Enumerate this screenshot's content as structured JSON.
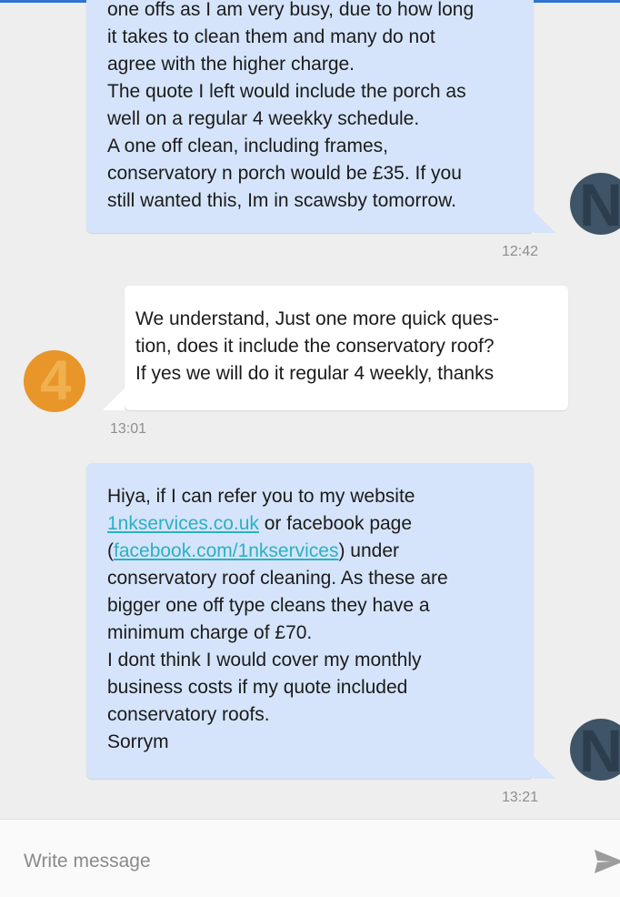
{
  "conversation": {
    "messages": [
      {
        "direction": "outgoing",
        "pre": "one offs as I am very busy, due to how long\nit takes to clean them and many do not\nagree with the higher charge.\nThe quote I left would include the porch as\nwell on a regular 4 weekky schedule.\nA one off clean, including frames,\nconservatory n porch would be £35.  If you\nstill wanted this, Im in scawsby tomorrow.",
        "time": "12:42",
        "avatar_letter": "N"
      },
      {
        "direction": "incoming",
        "pre": "We understand, Just one more quick ques-\ntion, does it include the conservatory roof?\nIf yes we will do it regular 4 weekly, thanks",
        "time": "13:01",
        "avatar_letter": "4"
      },
      {
        "direction": "outgoing",
        "pre": "Hiya, if I can refer you to my website\n",
        "link1": "1nkservices.co.uk",
        "mid1": " or facebook page\n(",
        "link2": "facebook.com/1nkservices",
        "post": ") under\nconservatory roof cleaning. As these are\nbigger one off type cleans they have a\nminimum charge of £70.\nI dont think I would cover my monthly\nbusiness costs if  my quote included\nconservatory roofs.\nSorrym",
        "time": "13:21",
        "avatar_letter": "N"
      }
    ]
  },
  "composer": {
    "placeholder": "Write message"
  },
  "icons": {
    "send": "send-icon"
  },
  "colors": {
    "outgoing_bubble": "#d5e4fa",
    "incoming_bubble": "#ffffff",
    "link": "#2bb0c4",
    "accent": "#2f74d0",
    "avatar_n": "#3f5466",
    "avatar_4": "#e8952a"
  }
}
